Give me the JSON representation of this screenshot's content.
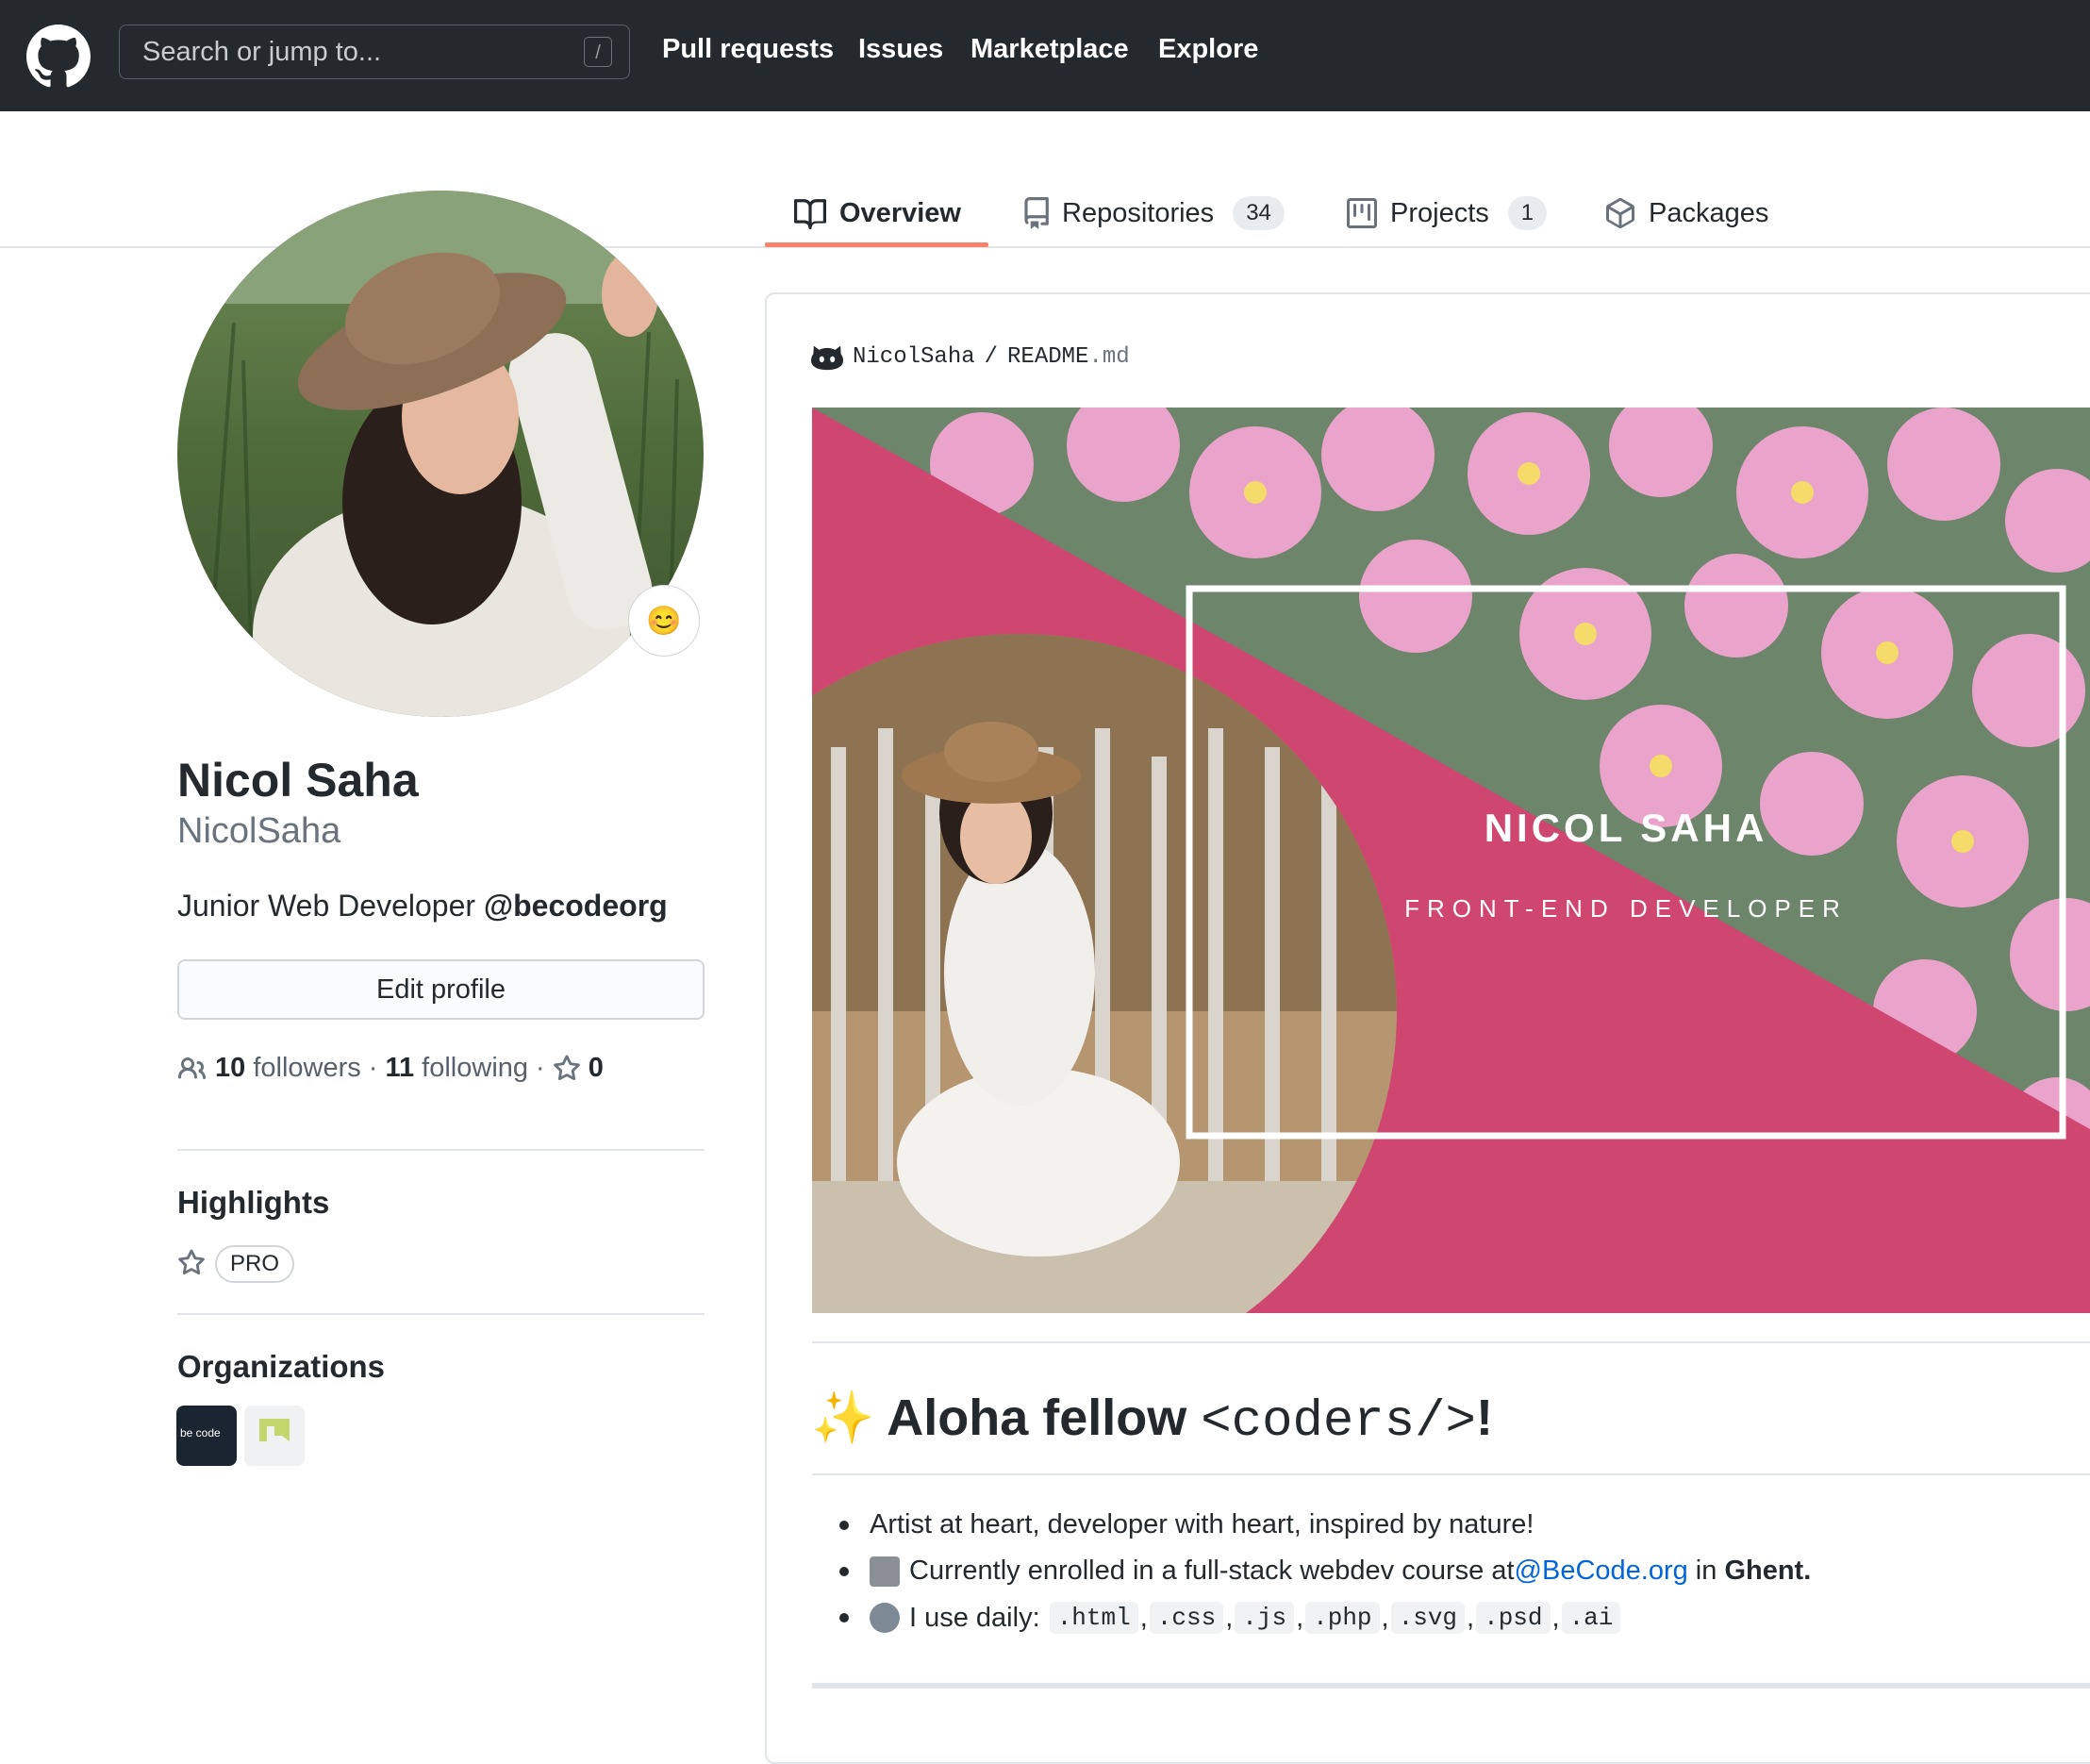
{
  "header": {
    "search_placeholder": "Search or jump to...",
    "slash_hint": "/",
    "nav": [
      "Pull requests",
      "Issues",
      "Marketplace",
      "Explore"
    ]
  },
  "tabs": {
    "overview": "Overview",
    "repositories": "Repositories",
    "repositories_count": "34",
    "projects": "Projects",
    "projects_count": "1",
    "packages": "Packages"
  },
  "profile": {
    "status_emoji": "😊",
    "full_name": "Nicol Saha",
    "username": "NicolSaha",
    "bio_prefix": "Junior Web Developer ",
    "bio_org": "@becodeorg",
    "edit_button": "Edit profile",
    "followers_count": "10",
    "followers_label": "followers",
    "following_count": "11",
    "following_label": "following",
    "dot": "·",
    "stars_count": "0"
  },
  "highlights": {
    "title": "Highlights",
    "badge": "PRO"
  },
  "organizations": {
    "title": "Organizations",
    "org1_logo_text": "be code"
  },
  "readme": {
    "owner": "NicolSaha",
    "path_sep": "/",
    "file": "README",
    "ext": ".md",
    "banner_name": "NICOL SAHA",
    "banner_role": "FRONT-END DEVELOPER",
    "greeting_emoji": "✨",
    "greeting_prefix": "Aloha fellow ",
    "greeting_code": "<coders/>",
    "greeting_suffix": "!",
    "bullet1": "Artist at heart, developer with heart, inspired by nature!",
    "bullet2_prefix": "Currently enrolled in a full-stack webdev course at ",
    "bullet2_link": "@BeCode.org",
    "bullet2_mid": " in ",
    "bullet2_city": "Ghent.",
    "bullet3_prefix": "I use daily: ",
    "tech": [
      ".html",
      ".css",
      ".js",
      ".php",
      ".svg",
      ".psd",
      ".ai"
    ],
    "comma": ","
  },
  "colors": {
    "header_bg": "#24292e",
    "tab_accent": "#f9826c",
    "banner_pink": "#cf4671",
    "link": "#0366d6"
  }
}
